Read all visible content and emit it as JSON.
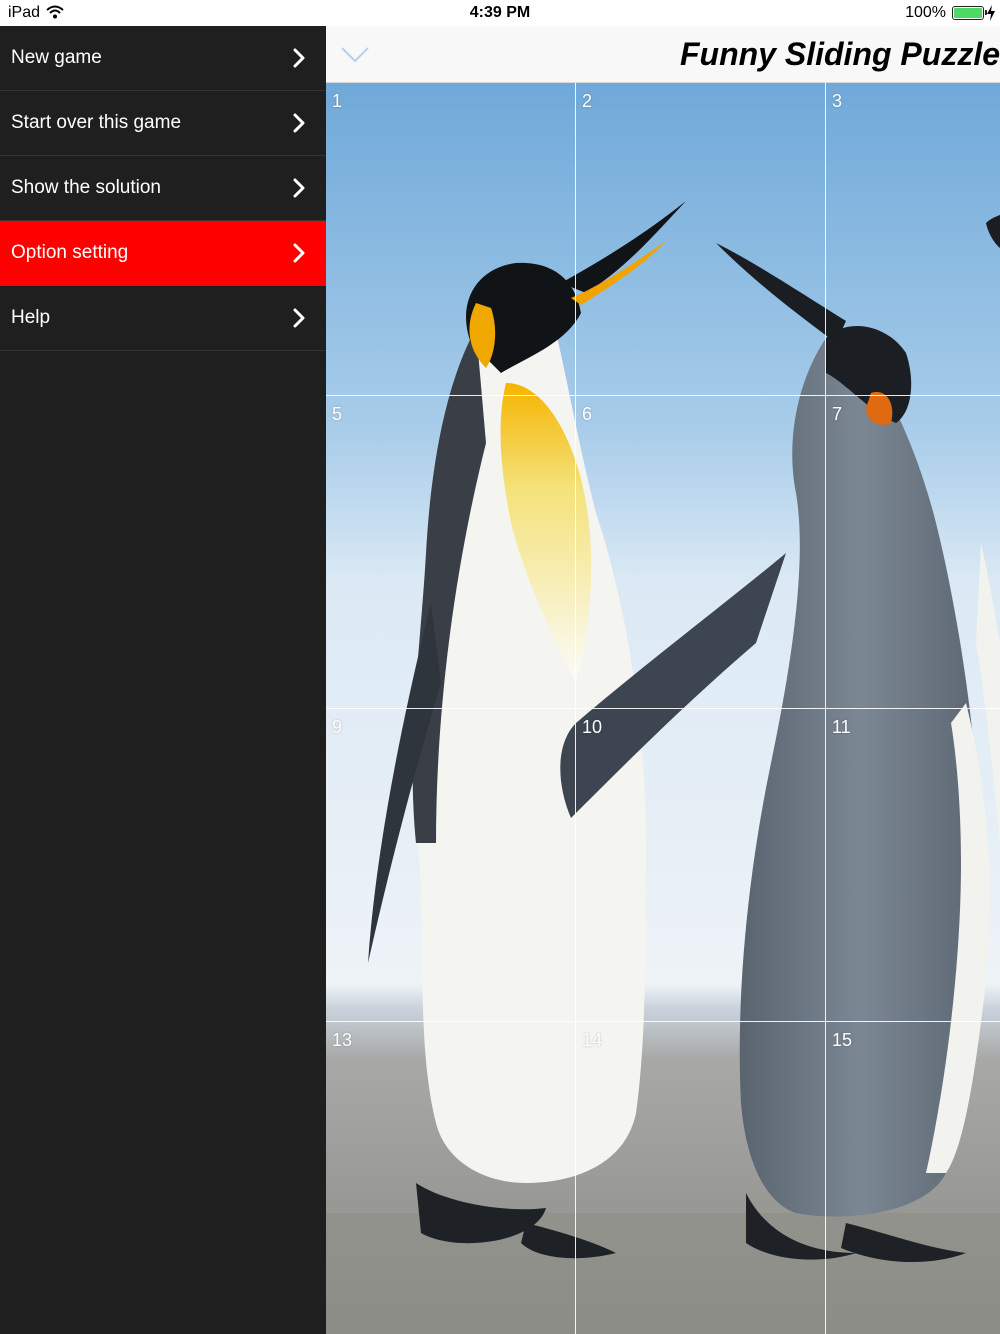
{
  "status_bar": {
    "device": "iPad",
    "time": "4:39 PM",
    "battery": "100%"
  },
  "menu": {
    "items": [
      {
        "label": "New game"
      },
      {
        "label": "Start over this game"
      },
      {
        "label": "Show the solution"
      },
      {
        "label": "Option setting",
        "active": true
      },
      {
        "label": "Help"
      }
    ]
  },
  "header": {
    "title": "Funny Sliding Puzzle"
  },
  "puzzle": {
    "tiles": [
      "1",
      "2",
      "3",
      "5",
      "6",
      "7",
      "9",
      "10",
      "11",
      "13",
      "14",
      "15"
    ]
  },
  "colors": {
    "menu_bg": "#1f1f1f",
    "active_item": "#ff0000",
    "battery": "#4cd964",
    "collapse_icon": "#b8d0ee"
  }
}
